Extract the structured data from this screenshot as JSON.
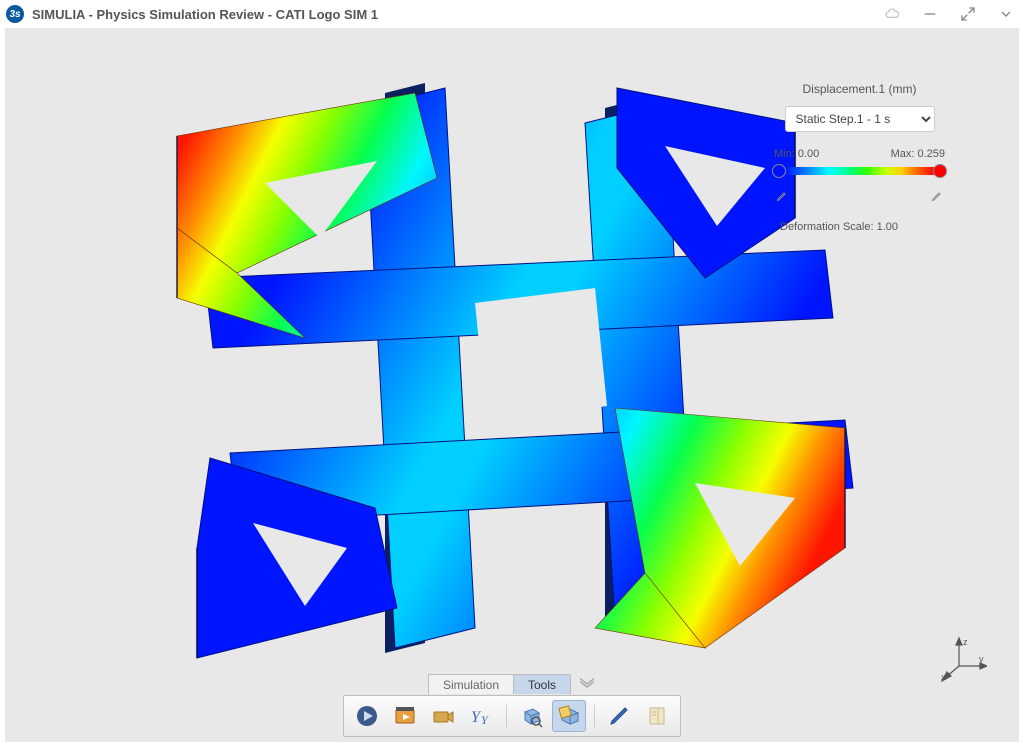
{
  "window": {
    "title": "SIMULIA - Physics Simulation Review - CATI Logo SIM 1"
  },
  "legend": {
    "title": "Displacement.1 (mm)",
    "step_selected": "Static Step.1 - 1 s",
    "step_options": [
      "Static Step.1 - 1 s"
    ],
    "min_label": "Min: 0.00",
    "max_label": "Max: 0.259",
    "deformation_label": "Deformation Scale: 1.00"
  },
  "triad": {
    "axes": {
      "x": "x",
      "y": "y",
      "z": "z"
    }
  },
  "tabs": {
    "simulation": "Simulation",
    "tools": "Tools",
    "active": "Tools"
  },
  "toolbar": {
    "items": [
      {
        "name": "play-results-button",
        "icon": "play",
        "active": false
      },
      {
        "name": "animate-button",
        "icon": "clapper",
        "active": false
      },
      {
        "name": "camera-button",
        "icon": "camera",
        "active": false
      },
      {
        "name": "symbol-plot-button",
        "icon": "yy",
        "active": false
      },
      {
        "sep": true
      },
      {
        "name": "fit-view-button",
        "icon": "cube-fit",
        "active": false
      },
      {
        "name": "section-view-button",
        "icon": "cube-sec",
        "active": true
      },
      {
        "sep": true
      },
      {
        "name": "annotate-button",
        "icon": "pencil",
        "active": false
      },
      {
        "name": "report-button",
        "icon": "book",
        "active": false
      }
    ]
  },
  "title_controls": {
    "cloud": "cloud-icon",
    "minimize": "minimize-icon",
    "expand": "expand-icon",
    "more": "more-icon"
  }
}
